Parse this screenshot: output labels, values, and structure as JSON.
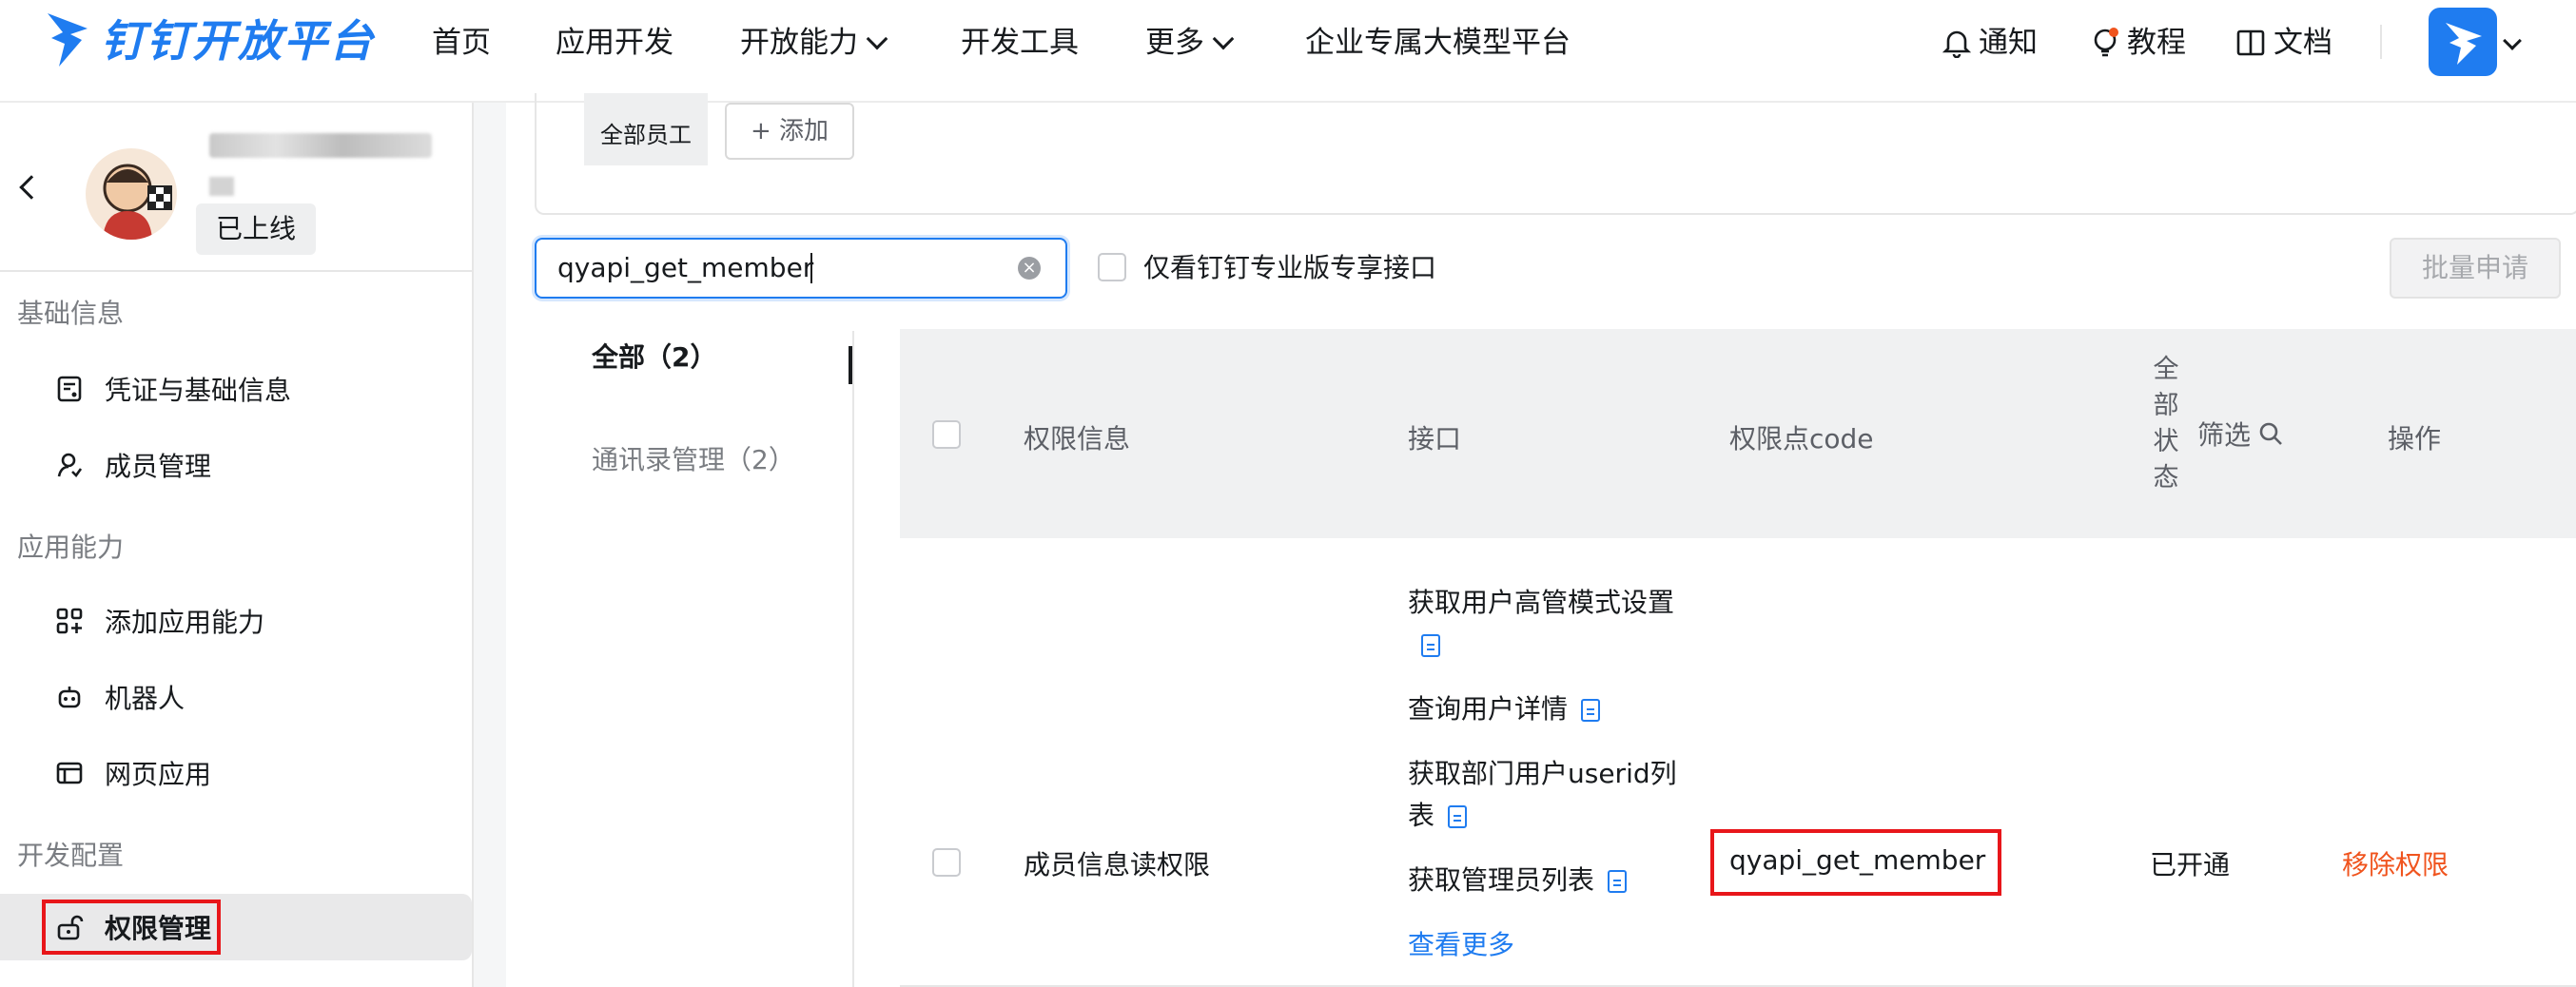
{
  "header": {
    "logo_text": "钉钉开放平台",
    "nav": [
      {
        "label": "首页"
      },
      {
        "label": "应用开发"
      },
      {
        "label": "开放能力"
      },
      {
        "label": "开发工具"
      },
      {
        "label": "更多"
      },
      {
        "label": "企业专属大模型平台"
      }
    ],
    "notify_label": "通知",
    "tutorial_label": "教程",
    "docs_label": "文档",
    "accent": "#1f7cf0"
  },
  "app": {
    "status_badge": "已上线"
  },
  "sidebar": {
    "sections": [
      {
        "title": "基础信息",
        "items": [
          {
            "label": "凭证与基础信息",
            "icon": "credential-icon"
          },
          {
            "label": "成员管理",
            "icon": "member-icon"
          }
        ]
      },
      {
        "title": "应用能力",
        "items": [
          {
            "label": "添加应用能力",
            "icon": "grid-add-icon"
          },
          {
            "label": "机器人",
            "icon": "robot-icon"
          },
          {
            "label": "网页应用",
            "icon": "webpage-icon"
          }
        ]
      },
      {
        "title": "开发配置",
        "items": [
          {
            "label": "权限管理",
            "icon": "unlock-icon",
            "active": true
          }
        ]
      }
    ]
  },
  "scope": {
    "tag": "全部员工",
    "add_label": "+ 添加"
  },
  "search": {
    "value": "qyapi_get_member",
    "only_pro_label": "仅看钉钉专业版专享接口",
    "batch_apply_label": "批量申请"
  },
  "categories": [
    {
      "label": "全部（2）",
      "active": true
    },
    {
      "label": "通讯录管理（2）",
      "active": false
    }
  ],
  "table": {
    "headers": {
      "info": "权限信息",
      "api": "接口",
      "code": "权限点code",
      "status_lines": [
        "全",
        "部",
        "状",
        "态"
      ],
      "filter": "筛选",
      "action": "操作"
    },
    "rows": [
      {
        "name": "成员信息读权限",
        "apis": [
          "获取用户高管模式设置",
          "查询用户详情",
          "获取部门用户userid列表",
          "获取管理员列表"
        ],
        "more": "查看更多",
        "code": "qyapi_get_member",
        "status": "已开通",
        "action": "移除权限"
      }
    ]
  }
}
